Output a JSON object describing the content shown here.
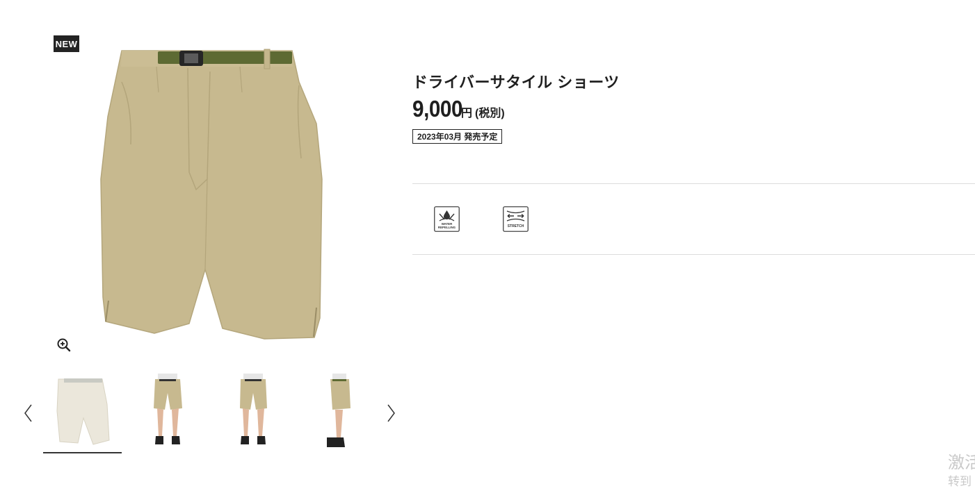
{
  "product": {
    "badge": "NEW",
    "title": "ドライバーサタイル ショーツ",
    "price": "9,000",
    "price_unit": "円",
    "tax_note": "(税別)",
    "release": "2023年03月 発売予定"
  },
  "features": [
    {
      "icon": "water-repelling-icon",
      "label_lines": [
        "WATER",
        "REPELLING"
      ]
    },
    {
      "icon": "stretch-icon",
      "label_lines": [
        "STRETCH"
      ]
    }
  ],
  "gallery": {
    "selected_index": 0,
    "thumbnails": [
      "ivory-shorts-thumb",
      "front-model-thumb",
      "front-model-thumb-2",
      "side-model-thumb"
    ]
  },
  "colors": {
    "shorts_beige": "#c7b98f",
    "belt_olive": "#5d6a33",
    "ivory": "#ebe7db",
    "text": "#1f1f1f",
    "divider": "#dcdcdc"
  },
  "watermark": {
    "line1": "激活",
    "line2": "转到"
  }
}
